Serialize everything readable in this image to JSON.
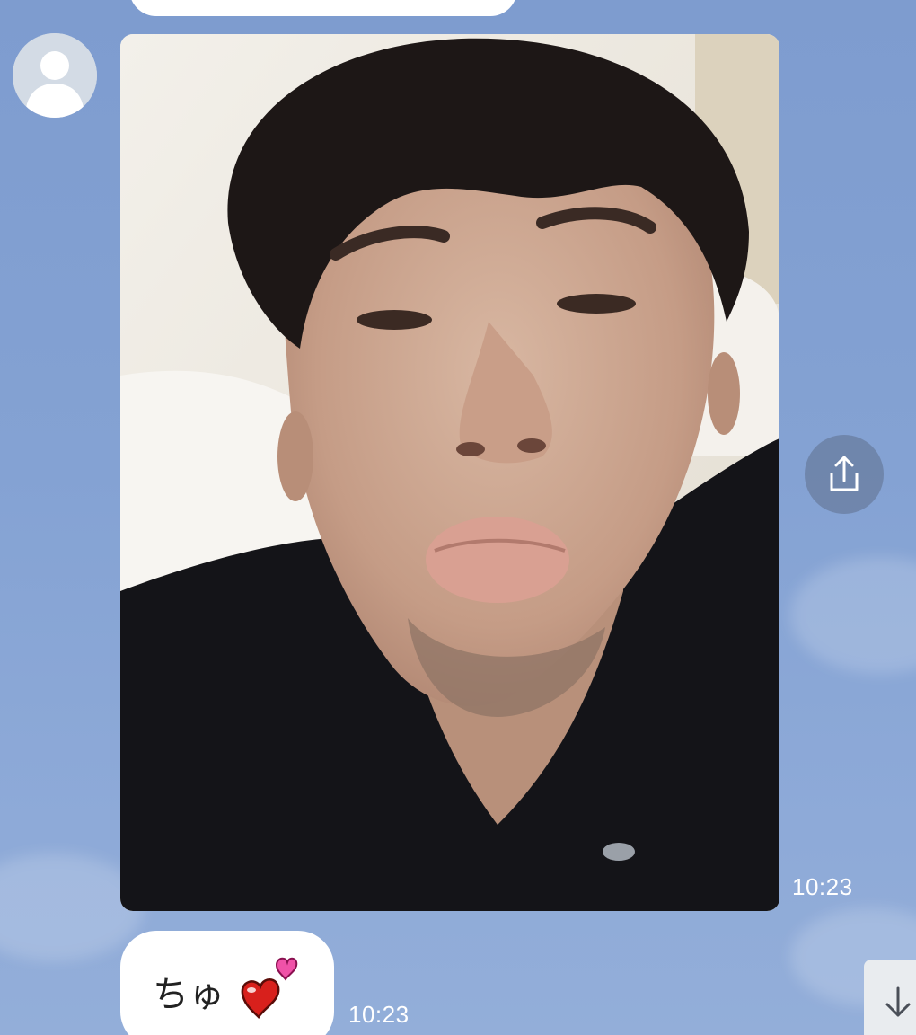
{
  "chat": {
    "messages": [
      {
        "type": "text",
        "partial": true
      },
      {
        "type": "image",
        "time": "10:23",
        "icon": "share-icon"
      },
      {
        "type": "text",
        "text": "ちゅ",
        "sticker": "hearts-emoji",
        "time": "10:23"
      }
    ]
  },
  "controls": {
    "scroll_icon": "arrow-down-icon"
  },
  "colors": {
    "background": "#84a2d3",
    "bubble": "#ffffff",
    "timestamp": "#ffffff"
  }
}
